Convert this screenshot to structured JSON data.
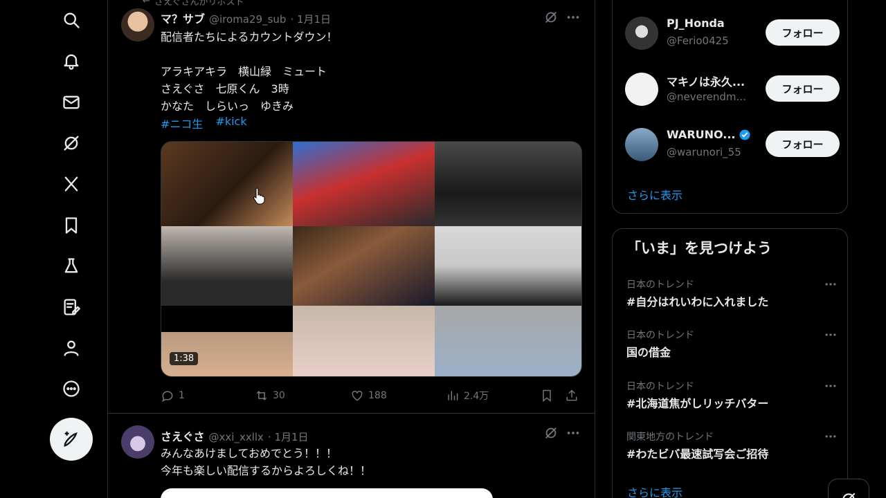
{
  "nav": {
    "items": [
      "search-icon",
      "notifications-icon",
      "messages-icon",
      "grok-icon",
      "x-icon",
      "bookmarks-icon",
      "labs-icon",
      "articles-icon",
      "profile-icon",
      "more-icon"
    ],
    "post_icon": "compose-icon"
  },
  "timeline": {
    "repost_note": "さえぐさんがリポスト",
    "tweet1": {
      "name": "マ？サブ",
      "handle": "@iroma29_sub",
      "date": "· 1月1日",
      "text": "配信者たちによるカウントダウン！\n\nアラキアキラ　横山緑　ミュート\nさえぐさ　七原くん　3時\nかなた　しらいっ　ゆきみ",
      "hashtags": [
        "#ニコ生",
        "#kick"
      ],
      "video_duration": "1:38",
      "replies": "1",
      "reposts": "30",
      "likes": "188",
      "views": "2.4万"
    },
    "tweet2": {
      "name": "さえぐさ",
      "handle": "@xxi_xxllx",
      "date": "· 1月1日",
      "text": "みんなあけましておめでとう！！！\n今年も楽しい配信するからよろしくね！！"
    }
  },
  "who_to_follow": {
    "users": [
      {
        "name": "PJ_Honda",
        "handle": "@Ferio0425",
        "button": "フォロー",
        "verified": false
      },
      {
        "name": "マキノは永久...",
        "handle": "@neverendm...",
        "button": "フォロー",
        "verified": false
      },
      {
        "name": "WARUNO...",
        "handle": "@warunori_55",
        "button": "フォロー",
        "verified": true
      }
    ],
    "show_more": "さらに表示"
  },
  "trends": {
    "title": "「いま」を見つけよう",
    "items": [
      {
        "category": "日本のトレンド",
        "name": "#自分はれいわに入れました"
      },
      {
        "category": "日本のトレンド",
        "name": "国の借金"
      },
      {
        "category": "日本のトレンド",
        "name": "#北海道焦がしリッチバター"
      },
      {
        "category": "関東地方のトレンド",
        "name": "#わたビバ最速試写会ご招待"
      }
    ],
    "show_more": "さらに表示"
  },
  "colors": {
    "background": "#000000",
    "text": "#e7e9ea",
    "muted": "#71767b",
    "accent": "#1d9bf0",
    "border": "#2f3336"
  }
}
